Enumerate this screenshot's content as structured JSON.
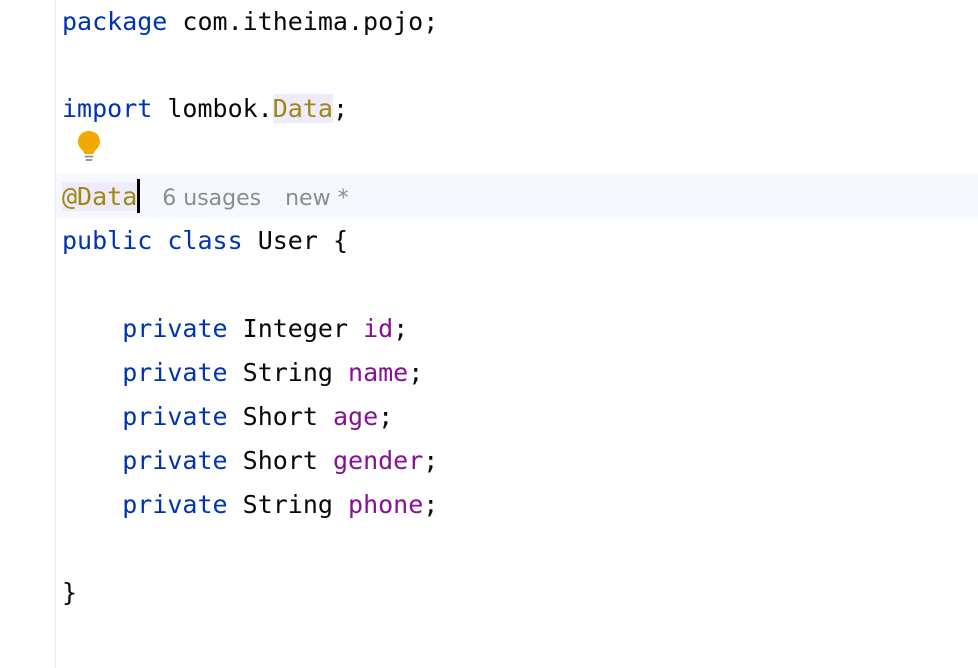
{
  "editor": {
    "package_kw": "package",
    "package_name": " com.itheima.pojo;",
    "import_kw": "import",
    "import_prefix": " lombok.",
    "import_anno": "Data",
    "import_semicolon": ";",
    "annotation": "@Data",
    "inlay_usages": "6 usages",
    "inlay_status": "new *",
    "class_kw1": "public",
    "class_kw2": "class",
    "class_rest": " User {",
    "fields": [
      {
        "modifier": "private",
        "type": "Integer",
        "name": "id"
      },
      {
        "modifier": "private",
        "type": "String",
        "name": "name"
      },
      {
        "modifier": "private",
        "type": "Short",
        "name": "age"
      },
      {
        "modifier": "private",
        "type": "Short",
        "name": "gender"
      },
      {
        "modifier": "private",
        "type": "String",
        "name": "phone"
      }
    ],
    "closing_brace": "}"
  },
  "icons": {
    "intention_bulb": "lightbulb-icon",
    "bulb_color": "#f2a900"
  }
}
